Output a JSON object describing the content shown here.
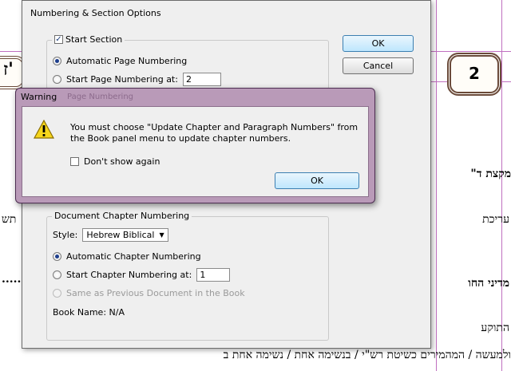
{
  "document": {
    "page_number": "2",
    "left_frame_text": "ז'",
    "heb_lines": [
      "מקצת ד\"",
      "עריכת",
      "תש",
      "מדיני החו",
      "התוקע",
      "ולמעשה / המהמירים כשיטת רש\"י / בנשימה אחת / נשימה אחת ב"
    ],
    "left_dots": "......."
  },
  "dialog": {
    "title": "Numbering & Section Options",
    "start_section_label": "Start Section",
    "start_section_checked": "✓",
    "auto_page_label": "Automatic Page Numbering",
    "start_page_label": "Start Page Numbering at:",
    "start_page_value": "2",
    "ok_label": "OK",
    "cancel_label": "Cancel",
    "chapter_group_label": "Document Chapter Numbering",
    "style_label": "Style:",
    "style_value": "Hebrew Biblical",
    "auto_chapter_label": "Automatic Chapter Numbering",
    "start_chapter_label": "Start Chapter Numbering at:",
    "start_chapter_value": "1",
    "same_as_prev_label": "Same as Previous Document in the Book",
    "book_name_label": "Book Name: N/A"
  },
  "warning": {
    "title": "Warning",
    "ghost_text": "Page Numbering",
    "message_line1": "You must choose \"Update Chapter and Paragraph Numbers\" from",
    "message_line2": "the Book panel menu to update chapter numbers.",
    "dont_show_label": "Don't show again",
    "ok_label": "OK",
    "icon": "warning-triangle-icon"
  },
  "colors": {
    "accent": "#3c7fb1",
    "warning_frame": "#b99ab8",
    "guide": "#c070c0"
  }
}
